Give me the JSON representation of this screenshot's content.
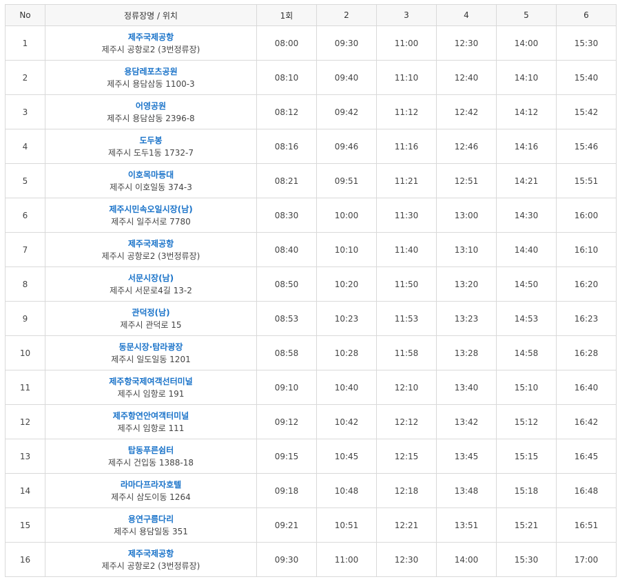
{
  "table": {
    "headers": [
      "No",
      "정류장명 / 위치",
      "1회",
      "2",
      "3",
      "4",
      "5",
      "6"
    ],
    "rows": [
      {
        "no": "1",
        "name": "제주국제공항",
        "addr": "제주시 공항로2 (3번정류장)",
        "times": [
          "08:00",
          "09:30",
          "11:00",
          "12:30",
          "14:00",
          "15:30"
        ]
      },
      {
        "no": "2",
        "name": "용담레포츠공원",
        "addr": "제주시 용담삼동 1100-3",
        "times": [
          "08:10",
          "09:40",
          "11:10",
          "12:40",
          "14:10",
          "15:40"
        ]
      },
      {
        "no": "3",
        "name": "어영공원",
        "addr": "제주시 용담삼동 2396-8",
        "times": [
          "08:12",
          "09:42",
          "11:12",
          "12:42",
          "14:12",
          "15:42"
        ]
      },
      {
        "no": "4",
        "name": "도두봉",
        "addr": "제주시 도두1동 1732-7",
        "times": [
          "08:16",
          "09:46",
          "11:16",
          "12:46",
          "14:16",
          "15:46"
        ]
      },
      {
        "no": "5",
        "name": "이호목마등대",
        "addr": "제주시 이호일동 374-3",
        "times": [
          "08:21",
          "09:51",
          "11:21",
          "12:51",
          "14:21",
          "15:51"
        ]
      },
      {
        "no": "6",
        "name": "제주시민속오일시장(남)",
        "addr": "제주시 일주서로 7780",
        "times": [
          "08:30",
          "10:00",
          "11:30",
          "13:00",
          "14:30",
          "16:00"
        ]
      },
      {
        "no": "7",
        "name": "제주국제공항",
        "addr": "제주시 공항로2 (3번정류장)",
        "times": [
          "08:40",
          "10:10",
          "11:40",
          "13:10",
          "14:40",
          "16:10"
        ]
      },
      {
        "no": "8",
        "name": "서문시장(남)",
        "addr": "제주시 서문로4길 13-2",
        "times": [
          "08:50",
          "10:20",
          "11:50",
          "13:20",
          "14:50",
          "16:20"
        ]
      },
      {
        "no": "9",
        "name": "관덕정(남)",
        "addr": "제주시 관덕로 15",
        "times": [
          "08:53",
          "10:23",
          "11:53",
          "13:23",
          "14:53",
          "16:23"
        ]
      },
      {
        "no": "10",
        "name": "동문시장·탐라광장",
        "addr": "제주시 일도일동 1201",
        "times": [
          "08:58",
          "10:28",
          "11:58",
          "13:28",
          "14:58",
          "16:28"
        ]
      },
      {
        "no": "11",
        "name": "제주항국제여객선터미널",
        "addr": "제주시 임항로 191",
        "times": [
          "09:10",
          "10:40",
          "12:10",
          "13:40",
          "15:10",
          "16:40"
        ]
      },
      {
        "no": "12",
        "name": "제주항연안여객터미널",
        "addr": "제주시 임항로 111",
        "times": [
          "09:12",
          "10:42",
          "12:12",
          "13:42",
          "15:12",
          "16:42"
        ]
      },
      {
        "no": "13",
        "name": "탑동푸른쉼터",
        "addr": "제주시 건입동 1388-18",
        "times": [
          "09:15",
          "10:45",
          "12:15",
          "13:45",
          "15:15",
          "16:45"
        ]
      },
      {
        "no": "14",
        "name": "라마다프라자호텔",
        "addr": "제주시 삼도이동 1264",
        "times": [
          "09:18",
          "10:48",
          "12:18",
          "13:48",
          "15:18",
          "16:48"
        ]
      },
      {
        "no": "15",
        "name": "용연구름다리",
        "addr": "제주시 용담일동 351",
        "times": [
          "09:21",
          "10:51",
          "12:21",
          "13:51",
          "15:21",
          "16:51"
        ]
      },
      {
        "no": "16",
        "name": "제주국제공항",
        "addr": "제주시 공항로2 (3번정류장)",
        "times": [
          "09:30",
          "11:00",
          "12:30",
          "14:00",
          "15:30",
          "17:00"
        ]
      }
    ]
  }
}
